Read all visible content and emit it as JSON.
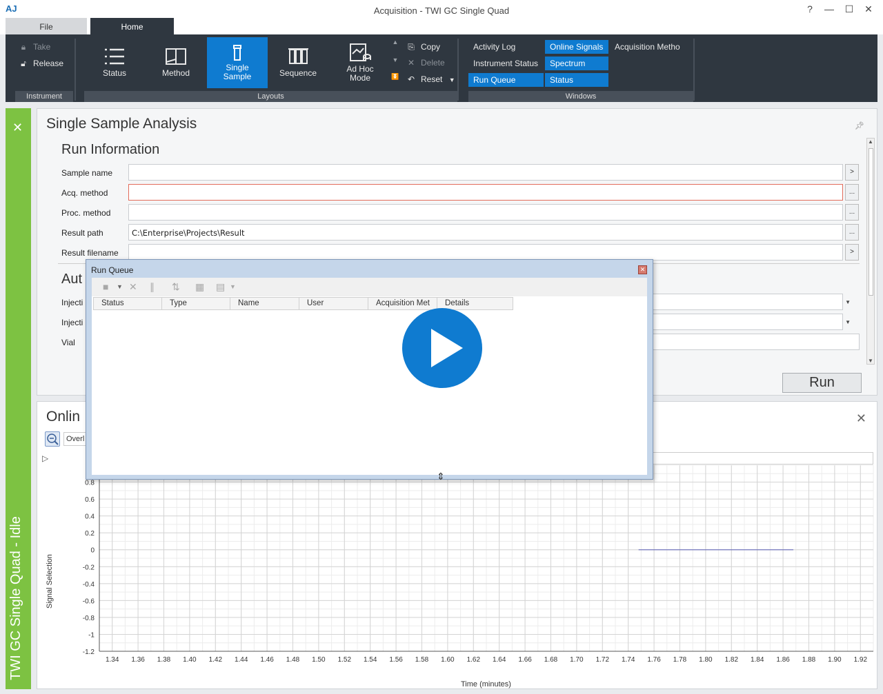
{
  "window": {
    "title": "Acquisition - TWI GC Single Quad",
    "app_logo": "AJ",
    "help": "?",
    "minimize": "—",
    "maximize": "☐",
    "close": "✕"
  },
  "tabs": [
    {
      "label": "File"
    },
    {
      "label": "Home"
    }
  ],
  "ribbon": {
    "instrument": {
      "take": "Take",
      "release": "Release",
      "group_label": "Instrument"
    },
    "layouts": {
      "buttons": [
        {
          "label_line1": "Status",
          "label_line2": ""
        },
        {
          "label_line1": "Method",
          "label_line2": ""
        },
        {
          "label_line1": "Single",
          "label_line2": "Sample"
        },
        {
          "label_line1": "Sequence",
          "label_line2": ""
        },
        {
          "label_line1": "Ad Hoc",
          "label_line2": "Mode"
        }
      ],
      "copy": "Copy",
      "delete": "Delete",
      "reset": "Reset",
      "group_label": "Layouts"
    },
    "windows": {
      "items": [
        "Activity Log",
        "Online Signals",
        "Acquisition Metho",
        "Instrument Status",
        "Spectrum",
        "Run Queue",
        "Status"
      ],
      "group_label": "Windows"
    }
  },
  "side_tab": {
    "label": "TWI GC Single Quad - Idle"
  },
  "single_sample": {
    "title": "Single Sample Analysis",
    "run_info_title": "Run Information",
    "fields": [
      {
        "label": "Sample name",
        "value": "",
        "button": ">"
      },
      {
        "label": "Acq. method",
        "value": "",
        "button": "..."
      },
      {
        "label": "Proc. method",
        "value": "",
        "button": "..."
      },
      {
        "label": "Result path",
        "value": "C:\\Enterprise\\Projects\\Result",
        "button": "..."
      },
      {
        "label": "Result filename",
        "value": "",
        "button": ">"
      }
    ],
    "auto_title": "Aut",
    "auto_fields": [
      "Injecti",
      "Injecti",
      "Vial"
    ],
    "run_button": "Run"
  },
  "online_signals": {
    "title": "Onlin",
    "overlay_select": "Overl",
    "ylabel": "Signal Selection",
    "xlabel": "Time (minutes)"
  },
  "chart_data": {
    "type": "line",
    "title": "",
    "xlabel": "Time (minutes)",
    "ylabel": "Signal Selection",
    "xlim": [
      1.33,
      1.93
    ],
    "ylim": [
      -1.2,
      1.0
    ],
    "x_ticks": [
      "1.34",
      "1.36",
      "1.38",
      "1.40",
      "1.42",
      "1.44",
      "1.46",
      "1.48",
      "1.50",
      "1.52",
      "1.54",
      "1.56",
      "1.58",
      "1.60",
      "1.62",
      "1.64",
      "1.66",
      "1.68",
      "1.70",
      "1.72",
      "1.74",
      "1.76",
      "1.78",
      "1.80",
      "1.82",
      "1.84",
      "1.86",
      "1.88",
      "1.90",
      "1.92"
    ],
    "y_ticks": [
      "0.8",
      "0.6",
      "0.4",
      "0.2",
      "0",
      "-0.2",
      "-0.4",
      "-0.6",
      "-0.8",
      "-1",
      "-1.2"
    ],
    "series": [
      {
        "x": [
          1.748,
          1.868
        ],
        "y": [
          0,
          0
        ],
        "color": "#5b5fb5"
      }
    ],
    "grid": true
  },
  "run_queue": {
    "title": "Run Queue",
    "columns": [
      "Status",
      "Type",
      "Name",
      "User",
      "Acquisition Met",
      "Details"
    ]
  },
  "colors": {
    "accent": "#0f7bd0",
    "ribbon": "#2f3740",
    "side_tab": "#7dc242"
  }
}
